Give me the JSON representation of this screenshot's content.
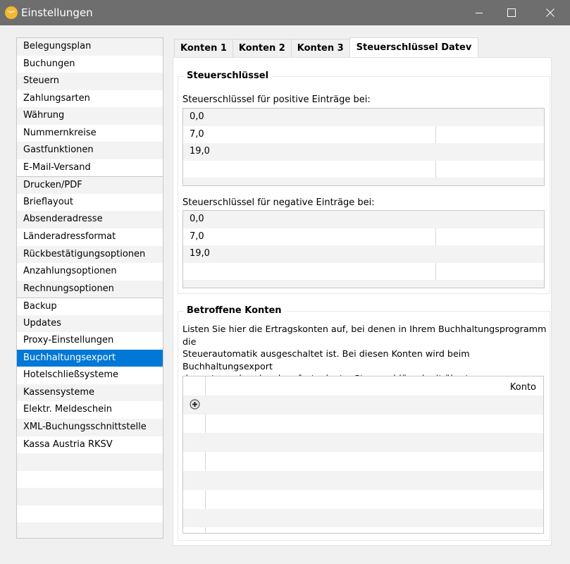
{
  "window": {
    "title": "Einstellungen",
    "icon": "app-logo-icon",
    "controls": [
      "minimize-icon",
      "maximize-icon",
      "close-icon"
    ]
  },
  "sidebar": {
    "selected": "Buchhaltungsexport",
    "items": [
      {
        "label": "Belegungsplan"
      },
      {
        "label": "Buchungen"
      },
      {
        "label": "Steuern"
      },
      {
        "label": "Zahlungsarten"
      },
      {
        "label": "Währung"
      },
      {
        "label": "Nummernkreise"
      },
      {
        "label": "Gastfunktionen"
      },
      {
        "label": "E-Mail-Versand"
      },
      {
        "label": "Drucken/PDF"
      },
      {
        "label": "Brieflayout"
      },
      {
        "label": "Absenderadresse"
      },
      {
        "label": "Länderadressformat"
      },
      {
        "label": "Rückbestätigungsoptionen"
      },
      {
        "label": "Anzahlungsoptionen"
      },
      {
        "label": "Rechnungsoptionen"
      },
      {
        "label": "Backup"
      },
      {
        "label": "Updates"
      },
      {
        "label": "Proxy-Einstellungen"
      },
      {
        "label": "Buchhaltungsexport"
      },
      {
        "label": "Hotelschließsysteme"
      },
      {
        "label": "Kassensysteme"
      },
      {
        "label": "Elektr. Meldeschein"
      },
      {
        "label": "XML-Buchungsschnittstelle"
      },
      {
        "label": "Kassa Austria RKSV"
      }
    ]
  },
  "tabs": [
    {
      "label": "Konten 1"
    },
    {
      "label": "Konten 2"
    },
    {
      "label": "Konten 3"
    },
    {
      "label": "Steuerschlüssel Datev",
      "active": true
    }
  ],
  "steuerschluessel": {
    "title": "Steuerschlüssel",
    "positive_label": "Steuerschlüssel für positive Einträge bei:",
    "positive_values": [
      "0,0",
      "7,0",
      "19,0"
    ],
    "negative_label": "Steuerschlüssel für negative Einträge bei:",
    "negative_values": [
      "0,0",
      "7,0",
      "19,0"
    ]
  },
  "betroffene_konten": {
    "title": "Betroffene Konten",
    "description_lines": [
      "Listen Sie hier die Ertragskonten auf, bei denen in Ihrem Buchhaltungsprogramm die",
      "Steuerautomatik ausgeschaltet ist. Bei diesen Konten wird beim Buchhaltungsexport",
      "der entsprechende, oben festgelegte, Steuerschlüssel mit übertragen."
    ],
    "column_header": "Konto",
    "add_row_icon": "add-circle-icon"
  }
}
